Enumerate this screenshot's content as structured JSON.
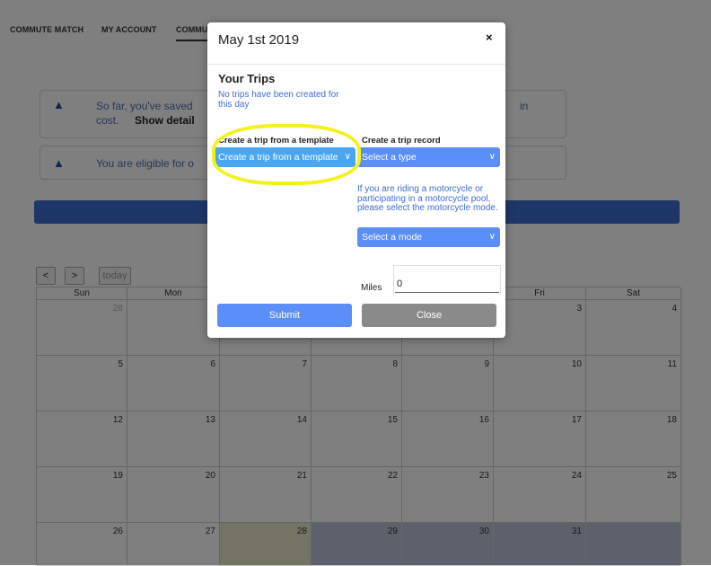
{
  "nav": {
    "items": [
      "COMMUTE MATCH",
      "MY ACCOUNT",
      "COMMU"
    ]
  },
  "notices": [
    {
      "text": "So far, you've saved",
      "detail_prefix": "cost.",
      "detail_link": "Show detail",
      "tail": "in"
    },
    {
      "text": "You are eligible for o"
    }
  ],
  "calendar": {
    "prev": "<",
    "next": ">",
    "today": "today",
    "weekdays": [
      "Sun",
      "Mon",
      "",
      "",
      "",
      "Fri",
      "Sat"
    ],
    "rows": [
      [
        "28",
        "",
        "",
        "",
        "",
        "3",
        "4"
      ],
      [
        "5",
        "6",
        "7",
        "8",
        "9",
        "10",
        "11"
      ],
      [
        "12",
        "13",
        "14",
        "15",
        "16",
        "17",
        "18"
      ],
      [
        "19",
        "20",
        "21",
        "22",
        "23",
        "24",
        "25"
      ],
      [
        "26",
        "27",
        "28",
        "29",
        "30",
        "31",
        ""
      ]
    ]
  },
  "modal": {
    "title": "May 1st 2019",
    "close_icon": "×",
    "section_title": "Your Trips",
    "no_trips": "No trips have been created for this day",
    "template_label": "Create a trip from a template",
    "template_select": "Create a trip from a template",
    "record_label": "Create a trip record",
    "type_select": "Select a type",
    "motorcycle_note": "If you are riding a motorcycle or participating in a motorcycle pool, please select the motorcycle mode.",
    "mode_select": "Select a mode",
    "miles_label": "Miles",
    "miles_value": "0",
    "submit": "Submit",
    "close": "Close"
  },
  "colors": {
    "accent": "#5b8ef7",
    "highlight": "#f5f11c",
    "link": "#3e6cd1"
  }
}
